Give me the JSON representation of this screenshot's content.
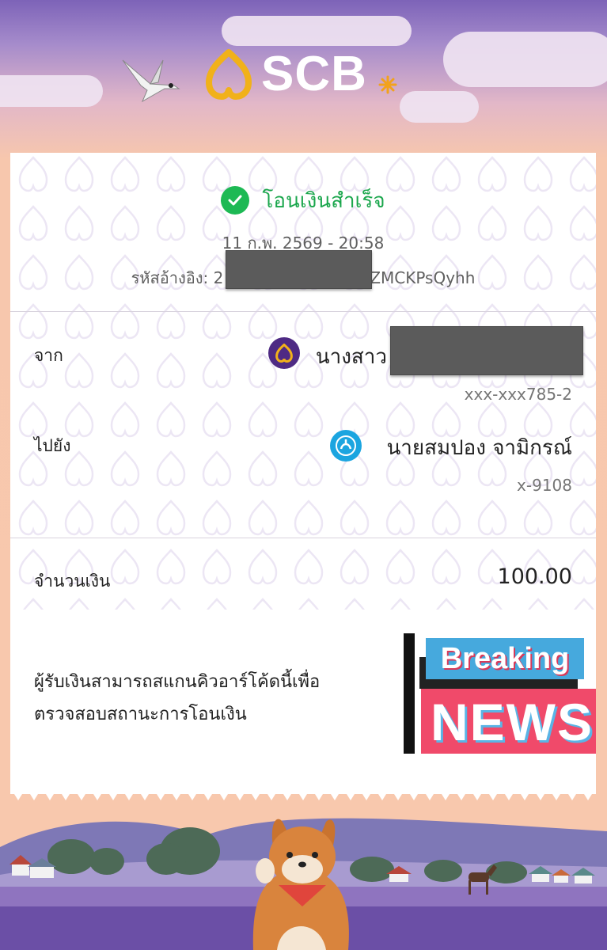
{
  "header": {
    "brand": "SCB",
    "brand_color": "#ffffff",
    "icons": [
      "bird-icon",
      "scb-logo-icon",
      "sparkle-icon"
    ]
  },
  "receipt": {
    "status": "โอนเงินสำเร็จ",
    "status_color": "#1aa64c",
    "datetime": "11 ก.พ. 2569 - 20:58",
    "ref_label": "รหัสอ้างอิง: 2",
    "ref_suffix": "ZMCKPsQyhh",
    "from": {
      "label": "จาก",
      "name": "นางสาว",
      "account": "xxx-xxx785-2",
      "bank_icon": "scb-bank-icon"
    },
    "to": {
      "label": "ไปยัง",
      "name": "นายสมปอง จามิกรณ์",
      "account": "x-9108",
      "bank_icon": "krungthai-bank-icon"
    },
    "amount": {
      "label": "จำนวนเงิน",
      "value": "100.00"
    },
    "qr_note": "ผู้รับเงินสามารถสแกนคิวอาร์โค้ดนี้เพื่อตรวจสอบสถานะการโอนเงิน",
    "sticker": {
      "line1": "Breaking",
      "line2": "NEWS"
    }
  },
  "footer": {
    "icons": [
      "shiba-dog-icon",
      "lavender-field-icon",
      "horse-icon",
      "houses-icon"
    ]
  }
}
